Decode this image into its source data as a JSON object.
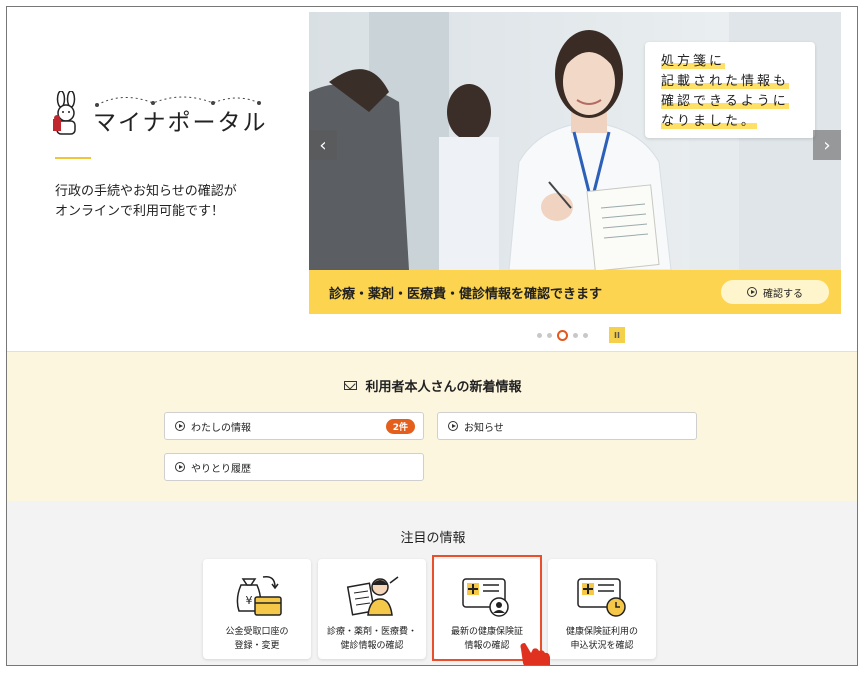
{
  "header": {
    "logo_text": "マイナポータル",
    "intro": "行政の手続やお知らせの確認が\nオンラインで利用可能です！"
  },
  "carousel": {
    "callout_lines": [
      "処方箋に",
      "記載された情報も",
      "確認できるように",
      "なりました。"
    ],
    "banner_text": "診療・薬剤・医療費・健診情報を確認できます",
    "banner_button": "確認する",
    "prev_label": "‹",
    "next_label": "›",
    "pause_label": "II",
    "slides_total": 5,
    "active_slide": 3
  },
  "news": {
    "title": "利用者本人さんの新着情報",
    "my_info_label": "わたしの情報",
    "my_info_badge": "2件",
    "notices_label": "お知らせ",
    "history_label": "やりとり履歴"
  },
  "featured": {
    "title": "注目の情報",
    "cards": [
      {
        "label": "公金受取口座の\n登録・変更",
        "icon": "money-bag-card-icon"
      },
      {
        "label": "診療・薬剤・医療費・\n健診情報の確認",
        "icon": "document-person-icon"
      },
      {
        "label": "最新の健康保険証\n情報の確認",
        "icon": "insurance-card-person-icon"
      },
      {
        "label": "健康保険証利用の\n申込状況を確認",
        "icon": "insurance-card-clock-icon"
      }
    ]
  },
  "colors": {
    "accent_yellow": "#fcd44f",
    "badge_orange": "#e45f1c",
    "highlight_red": "#e8502c"
  }
}
